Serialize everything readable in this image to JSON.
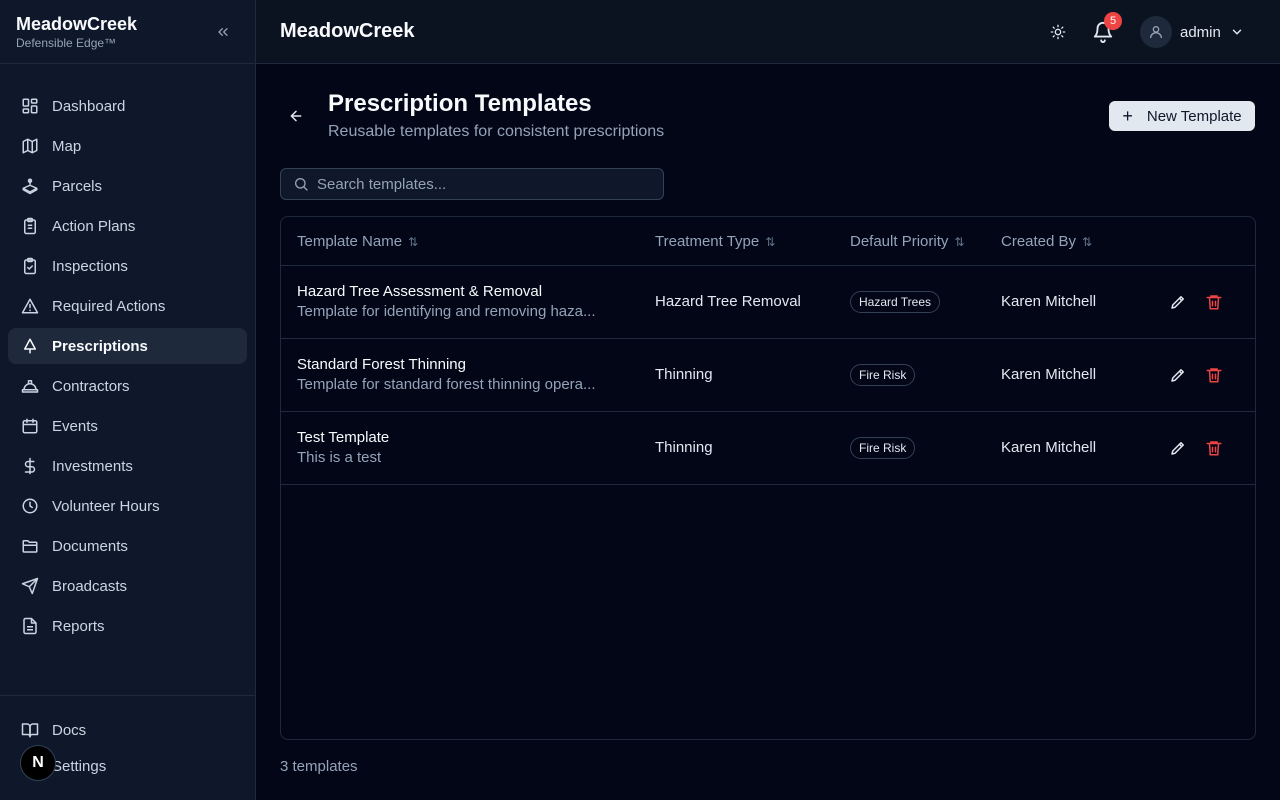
{
  "brand": {
    "title": "MeadowCreek",
    "subtitle": "Defensible Edge™"
  },
  "sidebar": {
    "items": [
      {
        "label": "Dashboard",
        "icon": "dashboard-icon"
      },
      {
        "label": "Map",
        "icon": "map-icon"
      },
      {
        "label": "Parcels",
        "icon": "parcels-icon"
      },
      {
        "label": "Action Plans",
        "icon": "clipboard-icon"
      },
      {
        "label": "Inspections",
        "icon": "clipboard-check-icon"
      },
      {
        "label": "Required Actions",
        "icon": "warning-icon"
      },
      {
        "label": "Prescriptions",
        "icon": "tree-icon",
        "active": true
      },
      {
        "label": "Contractors",
        "icon": "hard-hat-icon"
      },
      {
        "label": "Events",
        "icon": "calendar-icon"
      },
      {
        "label": "Investments",
        "icon": "dollar-icon"
      },
      {
        "label": "Volunteer Hours",
        "icon": "clock-icon"
      },
      {
        "label": "Documents",
        "icon": "folder-icon"
      },
      {
        "label": "Broadcasts",
        "icon": "send-icon"
      },
      {
        "label": "Reports",
        "icon": "file-text-icon"
      }
    ],
    "bottom": [
      {
        "label": "Docs",
        "icon": "book-icon"
      },
      {
        "label": "Settings",
        "icon": "gear-icon"
      }
    ],
    "n_badge": "N"
  },
  "topbar": {
    "title": "MeadowCreek",
    "notification_count": "5",
    "user": "admin"
  },
  "page": {
    "title": "Prescription Templates",
    "subtitle": "Reusable templates for consistent prescriptions",
    "new_button": "New Template",
    "search_placeholder": "Search templates..."
  },
  "table": {
    "columns": [
      "Template Name",
      "Treatment Type",
      "Default Priority",
      "Created By"
    ],
    "rows": [
      {
        "name": "Hazard Tree Assessment & Removal",
        "description": "Template for identifying and removing haza...",
        "treatment": "Hazard Tree Removal",
        "priority": "Hazard Trees",
        "created_by": "Karen Mitchell"
      },
      {
        "name": "Standard Forest Thinning",
        "description": "Template for standard forest thinning opera...",
        "treatment": "Thinning",
        "priority": "Fire Risk",
        "created_by": "Karen Mitchell"
      },
      {
        "name": "Test Template",
        "description": "This is a test",
        "treatment": "Thinning",
        "priority": "Fire Risk",
        "created_by": "Karen Mitchell"
      }
    ]
  },
  "footer": {
    "count": "3 templates"
  },
  "colors": {
    "accent": "#e2e8f0",
    "danger": "#ef4444",
    "background": "#020617",
    "sidebar": "#0f172a"
  }
}
